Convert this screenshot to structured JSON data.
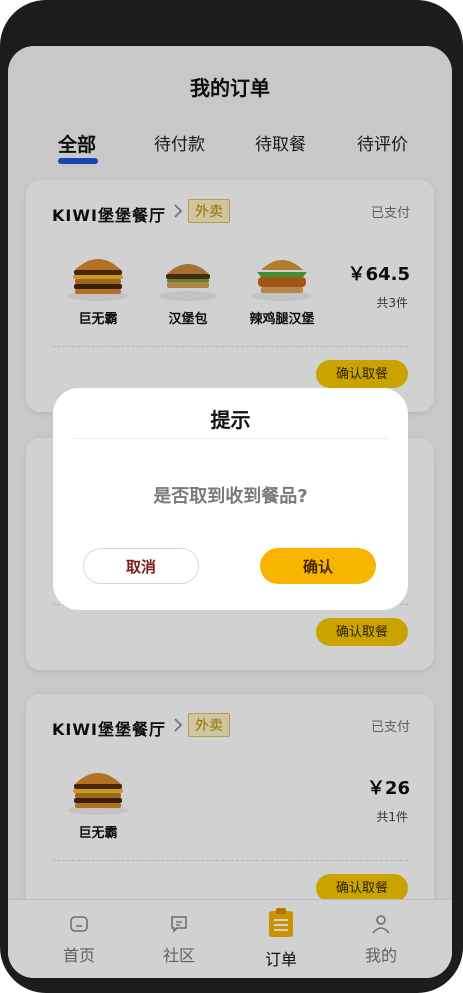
{
  "header": {
    "title": "我的订单"
  },
  "tabs": [
    {
      "label": "全部"
    },
    {
      "label": "待付款"
    },
    {
      "label": "待取餐"
    },
    {
      "label": "待评价"
    }
  ],
  "orders": [
    {
      "store": "KIWI堡堡餐厅",
      "tag": "外卖",
      "status": "已支付",
      "items": [
        {
          "name": "巨无霸",
          "icon": "big-mac-icon"
        },
        {
          "name": "汉堡包",
          "icon": "hamburger-icon"
        },
        {
          "name": "辣鸡腿汉堡",
          "icon": "chicken-burger-icon"
        }
      ],
      "price": "￥64.5",
      "count": "共3件",
      "action": "确认取餐"
    },
    {
      "store": "",
      "tag": "",
      "status": "",
      "items": [],
      "price": "",
      "count": "",
      "action": "确认取餐"
    },
    {
      "store": "KIWI堡堡餐厅",
      "tag": "外卖",
      "status": "已支付",
      "items": [
        {
          "name": "巨无霸",
          "icon": "big-mac-icon"
        }
      ],
      "price": "￥26",
      "count": "共1件",
      "action": "确认取餐"
    }
  ],
  "dialog": {
    "title": "提示",
    "message": "是否取到收到餐品?",
    "cancel_label": "取消",
    "confirm_label": "确认"
  },
  "nav": [
    {
      "label": "首页",
      "icon": "home-icon"
    },
    {
      "label": "社区",
      "icon": "chat-icon"
    },
    {
      "label": "订单",
      "icon": "clipboard-icon"
    },
    {
      "label": "我的",
      "icon": "user-icon"
    }
  ],
  "colors": {
    "accent": "#f7b500",
    "tab_indicator": "#1a56d6",
    "action_button": "#f6c700",
    "tag_bg": "#fdf2c4"
  }
}
